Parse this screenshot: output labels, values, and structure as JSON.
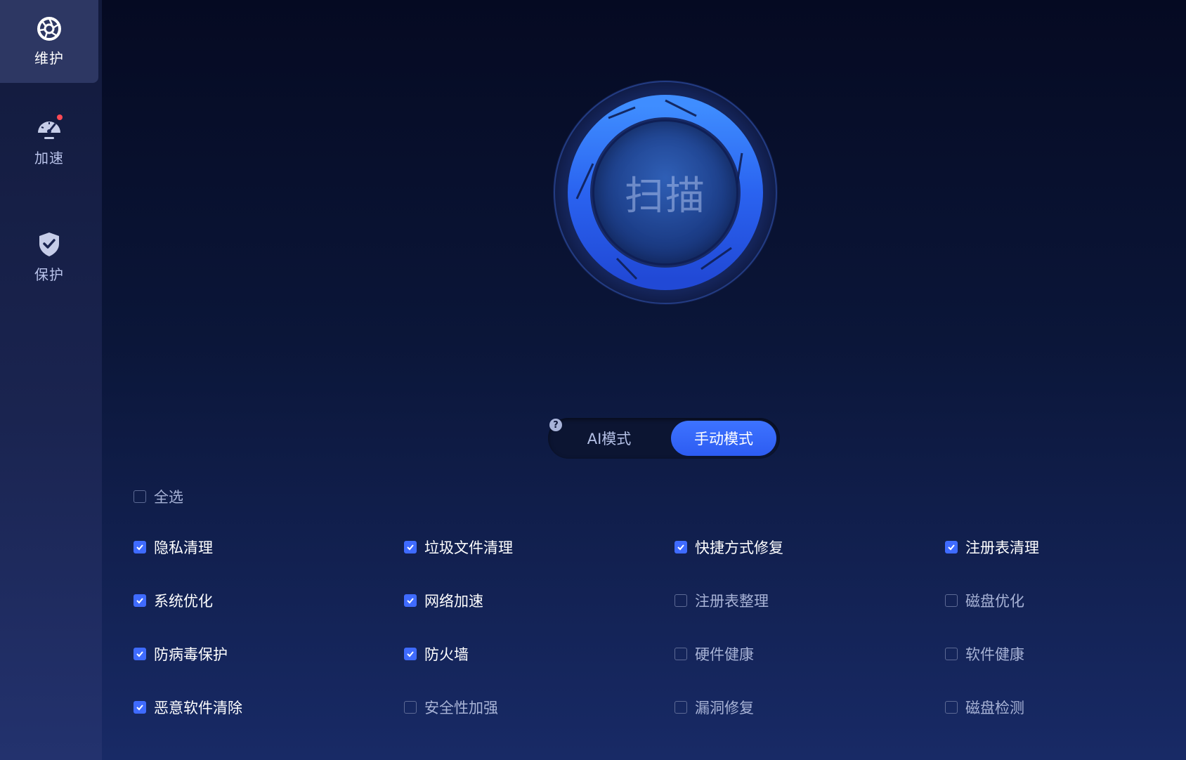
{
  "sidebar": {
    "items": [
      {
        "label": "维护",
        "icon": "aperture-icon",
        "active": true
      },
      {
        "label": "加速",
        "icon": "speedometer-icon",
        "badge": true
      },
      {
        "label": "保护",
        "icon": "shield-check-icon"
      }
    ]
  },
  "scan": {
    "label": "扫描"
  },
  "mode": {
    "help": "?",
    "ai_label": "AI模式",
    "manual_label": "手动模式",
    "selected": "manual"
  },
  "options": {
    "select_all": {
      "label": "全选",
      "checked": false
    },
    "items": [
      {
        "label": "隐私清理",
        "checked": true
      },
      {
        "label": "垃圾文件清理",
        "checked": true
      },
      {
        "label": "快捷方式修复",
        "checked": true
      },
      {
        "label": "注册表清理",
        "checked": true
      },
      {
        "label": "系统优化",
        "checked": true
      },
      {
        "label": "网络加速",
        "checked": true
      },
      {
        "label": "注册表整理",
        "checked": false
      },
      {
        "label": "磁盘优化",
        "checked": false
      },
      {
        "label": "防病毒保护",
        "checked": true
      },
      {
        "label": "防火墙",
        "checked": true
      },
      {
        "label": "硬件健康",
        "checked": false
      },
      {
        "label": "软件健康",
        "checked": false
      },
      {
        "label": "恶意软件清除",
        "checked": true
      },
      {
        "label": "安全性加强",
        "checked": false
      },
      {
        "label": "漏洞修复",
        "checked": false
      },
      {
        "label": "磁盘检测",
        "checked": false
      }
    ]
  },
  "colors": {
    "accent": "#3f6bff",
    "sidebar_active": "#2d3763",
    "badge": "#ff4a55"
  }
}
